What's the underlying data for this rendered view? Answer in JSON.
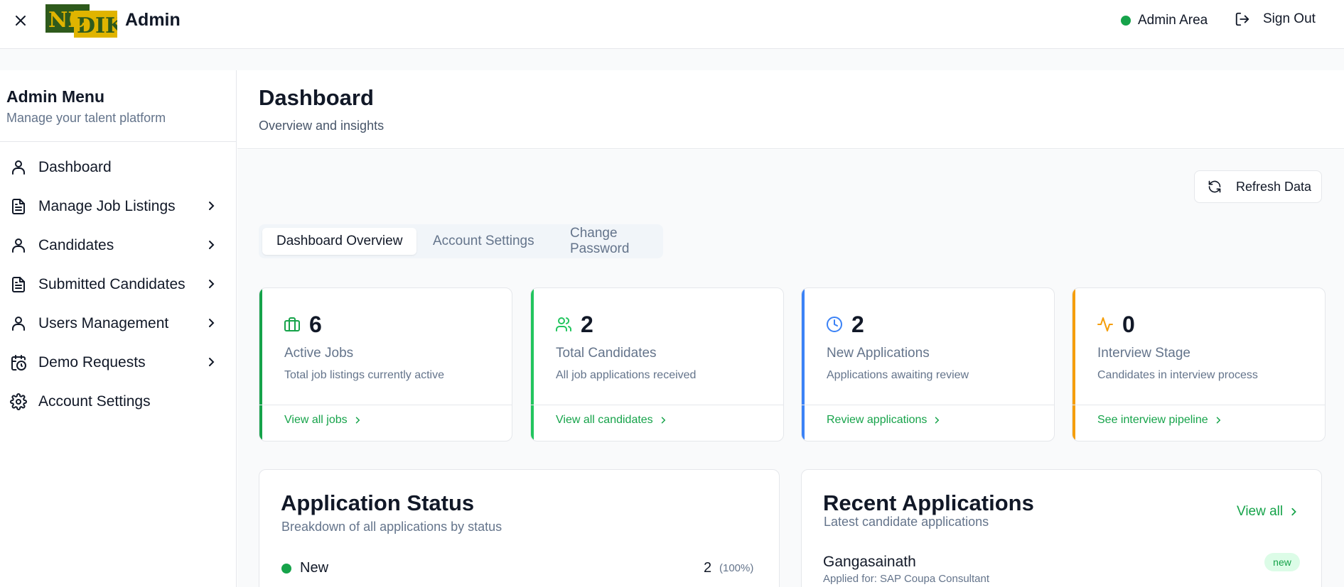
{
  "header": {
    "close_icon": "close-icon",
    "logo_text": "NICDIK",
    "title": "Admin",
    "area_label": "Admin Area",
    "signout_label": "Sign Out"
  },
  "sidebar": {
    "title": "Admin Menu",
    "subtitle": "Manage your talent platform",
    "items": [
      {
        "label": "Dashboard",
        "icon": "user-icon",
        "has_chevron": false
      },
      {
        "label": "Manage Job Listings",
        "icon": "document-icon",
        "has_chevron": true
      },
      {
        "label": "Candidates",
        "icon": "user-icon",
        "has_chevron": true
      },
      {
        "label": "Submitted Candidates",
        "icon": "document-icon",
        "has_chevron": true
      },
      {
        "label": "Users Management",
        "icon": "user-icon",
        "has_chevron": true
      },
      {
        "label": "Demo Requests",
        "icon": "calendar-clock-icon",
        "has_chevron": true
      },
      {
        "label": "Account Settings",
        "icon": "gear-icon",
        "has_chevron": false
      }
    ]
  },
  "main": {
    "title": "Dashboard",
    "subtitle": "Overview and insights",
    "refresh_label": "Refresh Data",
    "tabs": [
      {
        "label": "Dashboard Overview",
        "active": true
      },
      {
        "label": "Account Settings",
        "active": false
      },
      {
        "label": "Change Password",
        "active": false
      }
    ],
    "stats": [
      {
        "value": "6",
        "name": "Active Jobs",
        "desc": "Total job listings currently active",
        "link": "View all jobs",
        "color": "#16a34a",
        "icon": "briefcase-icon"
      },
      {
        "value": "2",
        "name": "Total Candidates",
        "desc": "All job applications received",
        "link": "View all candidates",
        "color": "#22c55e",
        "icon": "users-icon"
      },
      {
        "value": "2",
        "name": "New Applications",
        "desc": "Applications awaiting review",
        "link": "Review applications",
        "color": "#3b82f6",
        "icon": "clock-icon"
      },
      {
        "value": "0",
        "name": "Interview Stage",
        "desc": "Candidates in interview process",
        "link": "See interview pipeline",
        "color": "#f59e0b",
        "icon": "activity-icon"
      }
    ],
    "application_status": {
      "title": "Application Status",
      "subtitle": "Breakdown of all applications by status",
      "rows": [
        {
          "label": "New",
          "count": "2",
          "percent": "(100%)"
        }
      ]
    },
    "recent_applications": {
      "title": "Recent Applications",
      "subtitle": "Latest candidate applications",
      "view_all": "View all",
      "items": [
        {
          "name": "Gangasainath",
          "applied_for": "Applied for: SAP Coupa Consultant",
          "badge": "new"
        }
      ]
    }
  },
  "colors": {
    "accent": "#16a34a",
    "muted": "#64748b",
    "border": "#e5e7eb"
  }
}
